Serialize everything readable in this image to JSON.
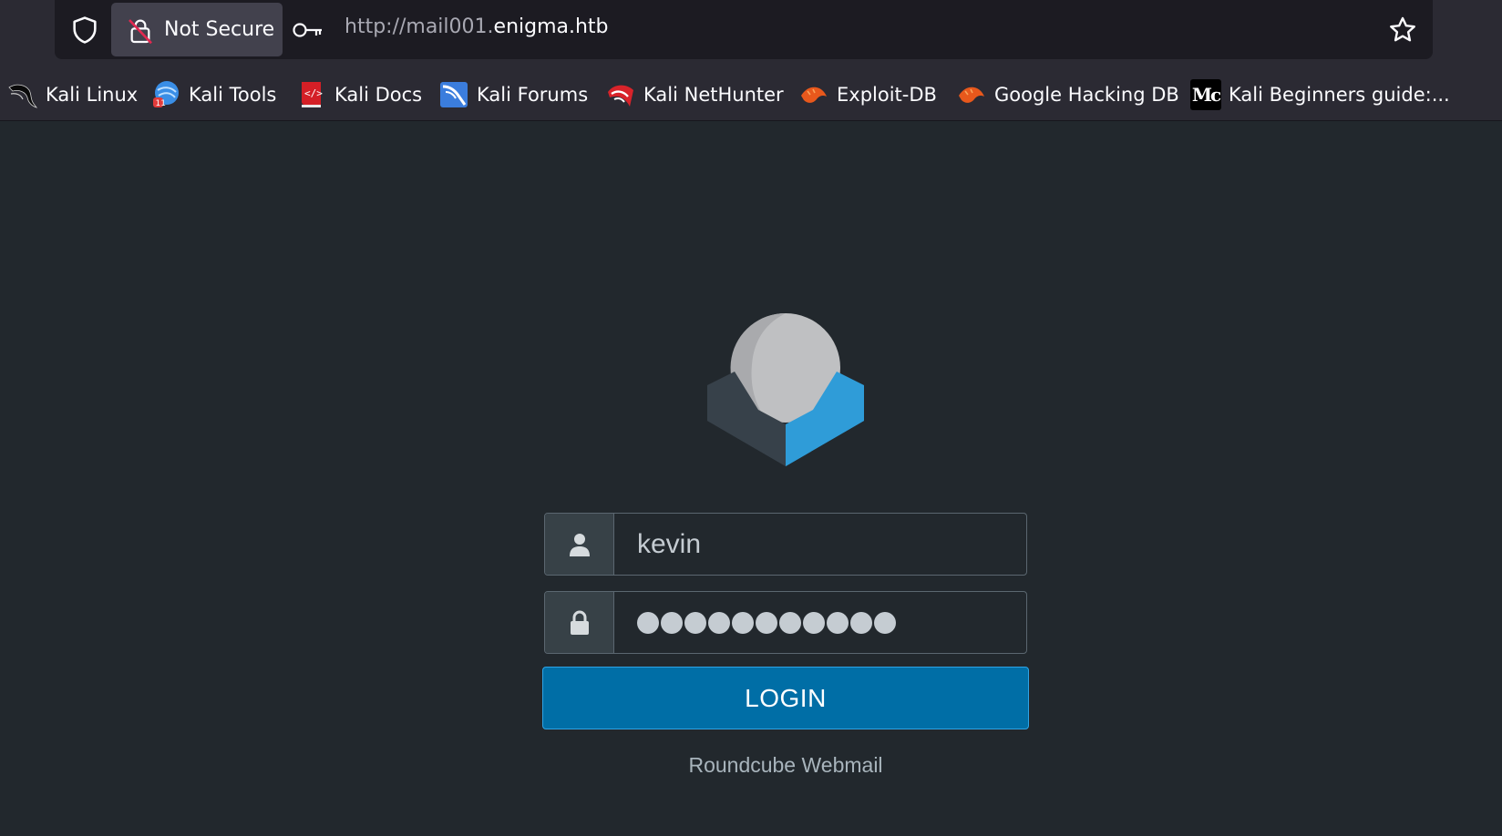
{
  "browser": {
    "security_label": "Not Secure",
    "url_scheme": "http://mail001.",
    "url_host": "enigma.htb",
    "icons": [
      "shield-icon",
      "insecure-lock-icon",
      "key-icon",
      "bookmark-star-icon"
    ]
  },
  "bookmarks": [
    {
      "label": "Kali Linux",
      "icon": "kali-dragon-icon"
    },
    {
      "label": "Kali Tools",
      "icon": "kali-tools-icon"
    },
    {
      "label": "Kali Docs",
      "icon": "kali-docs-icon"
    },
    {
      "label": "Kali Forums",
      "icon": "kali-forums-icon"
    },
    {
      "label": "Kali NetHunter",
      "icon": "kali-nethunter-icon"
    },
    {
      "label": "Exploit-DB",
      "icon": "exploit-db-icon"
    },
    {
      "label": "Google Hacking DB",
      "icon": "google-hacking-db-icon"
    },
    {
      "label": "Kali Beginners guide:...",
      "icon": "medium-icon",
      "favicon_text": "Mc"
    }
  ],
  "login": {
    "username_value": "kevin",
    "password_mask_count": 11,
    "submit_label": "LOGIN",
    "footer_text": "Roundcube Webmail"
  },
  "colors": {
    "page_bg": "#22282d",
    "accent": "#006ea6",
    "logo_blue": "#2f9cd8",
    "logo_dark": "#37414a",
    "logo_grey": "#bfc0c2"
  }
}
